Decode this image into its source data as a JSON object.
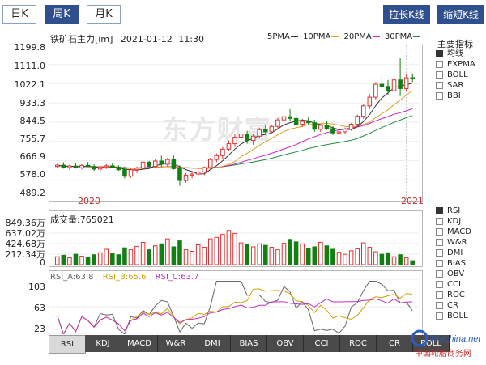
{
  "period_tabs": [
    {
      "label": "日K",
      "active": false
    },
    {
      "label": "周K",
      "active": true
    },
    {
      "label": "月K",
      "active": false
    }
  ],
  "tools": {
    "zoom_in": "拉长K线",
    "zoom_out": "缩短K线"
  },
  "header": {
    "title": "铁矿石主力[im]",
    "date": "2021-01-12",
    "time": "11:30"
  },
  "ma_legend": [
    {
      "label": "5PMA",
      "color": "#333333"
    },
    {
      "label": "10PMA",
      "color": "#e0a020"
    },
    {
      "label": "20PMA",
      "color": "#d020d0"
    },
    {
      "label": "30PMA",
      "color": "#209040"
    }
  ],
  "price_axis": [
    "1199.8",
    "1111.0",
    "1022.1",
    "933.3",
    "844.5",
    "755.7",
    "666.9",
    "578.0",
    "489.2"
  ],
  "x_labels": {
    "left": "2020",
    "right": "2021"
  },
  "watermark": "东方财富",
  "side_panel": {
    "title": "主要指标",
    "main_indicators": [
      {
        "label": "均线",
        "checked": true
      },
      {
        "label": "EXPMA",
        "checked": false
      },
      {
        "label": "BOLL",
        "checked": false
      },
      {
        "label": "SAR",
        "checked": false
      },
      {
        "label": "BBI",
        "checked": false
      }
    ],
    "sub_indicators": [
      {
        "label": "RSI",
        "checked": true
      },
      {
        "label": "KDJ",
        "checked": false
      },
      {
        "label": "MACD",
        "checked": false
      },
      {
        "label": "W&R",
        "checked": false
      },
      {
        "label": "DMI",
        "checked": false
      },
      {
        "label": "BIAS",
        "checked": false
      },
      {
        "label": "OBV",
        "checked": false
      },
      {
        "label": "CCI",
        "checked": false
      },
      {
        "label": "ROC",
        "checked": false
      },
      {
        "label": "CR",
        "checked": false
      },
      {
        "label": "BOLL",
        "checked": false
      }
    ]
  },
  "volume": {
    "label": "成交量",
    "value": "765021",
    "axis": [
      "849.36万",
      "637.02万",
      "424.68万",
      "212.34万",
      "0"
    ]
  },
  "rsi": {
    "legend": [
      {
        "label": "RSI_A:63.8",
        "color": "#666666"
      },
      {
        "label": "RSI_B:65.6",
        "color": "#d0a000"
      },
      {
        "label": "RSI_C:63.7",
        "color": "#c030c0"
      }
    ],
    "axis": [
      "103",
      "63",
      "23"
    ]
  },
  "bottom_tabs": [
    "RSI",
    "KDJ",
    "MACD",
    "W&R",
    "DMI",
    "BIAS",
    "OBV",
    "CCI",
    "ROC",
    "CR",
    "BOLL"
  ],
  "branding": {
    "site": "Tirechina.net",
    "name": "中国轮胎商务网"
  },
  "colors": {
    "up": "#e03030",
    "down": "#108010",
    "accent": "#2f4f8f"
  },
  "chart_data": {
    "type": "candlestick",
    "price_range": [
      489.2,
      1199.8
    ],
    "candles": [
      [
        640,
        652,
        632,
        646
      ],
      [
        646,
        660,
        630,
        635
      ],
      [
        635,
        648,
        625,
        642
      ],
      [
        642,
        655,
        630,
        634
      ],
      [
        634,
        650,
        626,
        645
      ],
      [
        645,
        660,
        638,
        640
      ],
      [
        640,
        650,
        620,
        628
      ],
      [
        628,
        645,
        615,
        638
      ],
      [
        638,
        650,
        628,
        643
      ],
      [
        643,
        655,
        632,
        636
      ],
      [
        636,
        645,
        620,
        625
      ],
      [
        625,
        640,
        585,
        595
      ],
      [
        595,
        630,
        588,
        625
      ],
      [
        625,
        640,
        610,
        632
      ],
      [
        632,
        670,
        625,
        660
      ],
      [
        660,
        665,
        630,
        640
      ],
      [
        640,
        672,
        635,
        665
      ],
      [
        665,
        690,
        640,
        650
      ],
      [
        650,
        680,
        640,
        672
      ],
      [
        672,
        690,
        625,
        630
      ],
      [
        630,
        645,
        550,
        575
      ],
      [
        575,
        610,
        565,
        600
      ],
      [
        600,
        615,
        585,
        605
      ],
      [
        605,
        625,
        595,
        615
      ],
      [
        615,
        640,
        600,
        635
      ],
      [
        635,
        680,
        628,
        672
      ],
      [
        672,
        700,
        660,
        690
      ],
      [
        690,
        730,
        675,
        720
      ],
      [
        720,
        760,
        710,
        745
      ],
      [
        745,
        790,
        730,
        775
      ],
      [
        775,
        800,
        760,
        790
      ],
      [
        790,
        805,
        745,
        760
      ],
      [
        760,
        790,
        740,
        780
      ],
      [
        780,
        820,
        770,
        810
      ],
      [
        810,
        835,
        790,
        800
      ],
      [
        800,
        830,
        795,
        825
      ],
      [
        825,
        865,
        815,
        855
      ],
      [
        855,
        890,
        845,
        870
      ],
      [
        870,
        905,
        850,
        862
      ],
      [
        862,
        880,
        820,
        835
      ],
      [
        835,
        860,
        822,
        848
      ],
      [
        848,
        870,
        830,
        842
      ],
      [
        842,
        856,
        800,
        812
      ],
      [
        812,
        835,
        800,
        830
      ],
      [
        830,
        848,
        808,
        815
      ],
      [
        815,
        825,
        785,
        795
      ],
      [
        795,
        810,
        770,
        800
      ],
      [
        800,
        820,
        790,
        812
      ],
      [
        812,
        840,
        805,
        835
      ],
      [
        835,
        880,
        828,
        872
      ],
      [
        872,
        930,
        860,
        920
      ],
      [
        920,
        975,
        905,
        960
      ],
      [
        960,
        1030,
        948,
        1020
      ],
      [
        1020,
        1060,
        1000,
        1010
      ],
      [
        1010,
        1040,
        970,
        990
      ],
      [
        990,
        1050,
        980,
        1040
      ],
      [
        1040,
        1140,
        965,
        1000
      ],
      [
        1000,
        1065,
        990,
        1050
      ],
      [
        1050,
        1070,
        1030,
        1045
      ]
    ],
    "volumes": [
      1.6,
      1.9,
      1.4,
      2.1,
      1.7,
      1.5,
      2.0,
      2.4,
      3.1,
      2.2,
      2.0,
      3.4,
      3.0,
      3.7,
      4.5,
      3.0,
      3.8,
      4.2,
      5.2,
      3.6,
      4.8,
      3.0,
      2.7,
      4.0,
      3.5,
      5.2,
      5.5,
      6.1,
      6.9,
      6.3,
      4.4,
      4.0,
      3.6,
      4.2,
      3.9,
      3.5,
      3.0,
      4.3,
      5.1,
      4.6,
      4.2,
      3.3,
      3.6,
      4.5,
      3.8,
      3.1,
      2.5,
      2.1,
      2.8,
      3.2,
      4.4,
      3.5,
      2.6,
      2.1,
      2.4,
      1.6,
      2.0,
      1.4,
      0.8
    ],
    "volume_range": [
      0,
      849.36
    ],
    "rsi_range": [
      23,
      103
    ]
  }
}
